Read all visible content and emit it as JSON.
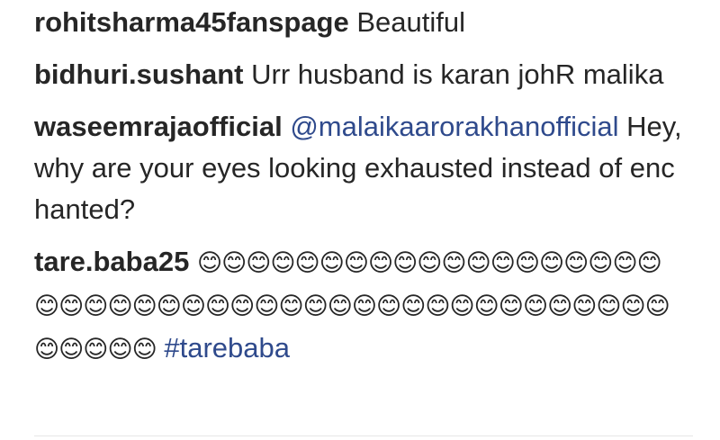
{
  "comments": [
    {
      "username": "rohitsharma45fanspage",
      "text": "Beautiful"
    },
    {
      "username": "bidhuri.sushant",
      "text": "Urr husband is karan johR malika"
    },
    {
      "username": "waseemrajaofficial",
      "mention": "@malaikaarorakhanofficial",
      "text": "Hey, why are your eyes looking exhausted instead of enchanted?"
    },
    {
      "username": "tare.baba25",
      "emoji": "😊😊😊😊😊😊😊😊😊😊😊😊😊😊😊😊😊😊😊😊😊😊😊😊😊😊😊😊😊😊😊😊😊😊😊😊😊😊😊😊😊😊😊😊😊😊😊😊😊😊",
      "hashtag": "#tarebaba"
    }
  ]
}
